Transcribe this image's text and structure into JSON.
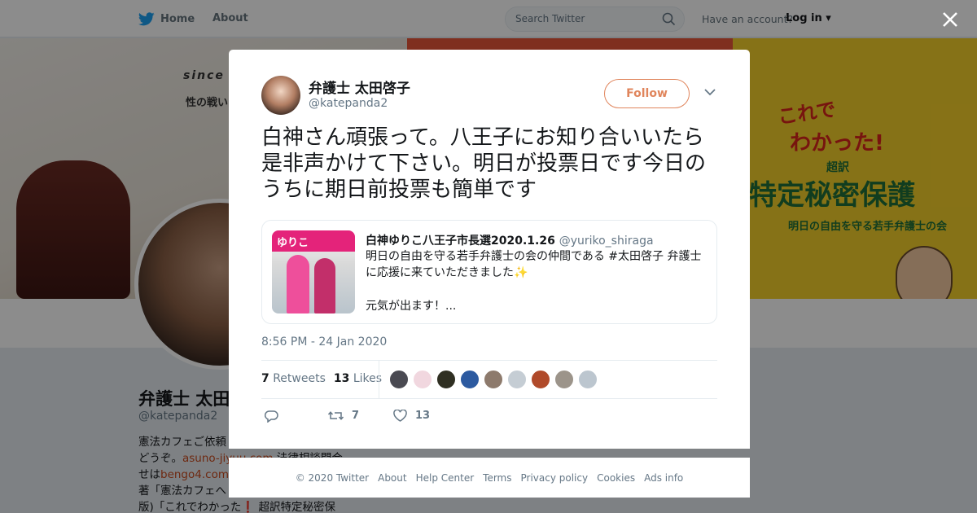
{
  "nav": {
    "home_label": "Home",
    "about_label": "About",
    "search_placeholder": "Search Twitter",
    "have_account": "Have an account?",
    "login_label": "Log in"
  },
  "banner": {
    "since_text": "since",
    "left_line": "性の戦い",
    "book_title1": "これで",
    "book_title2": "わかった!",
    "book_chouyaku": "超訳",
    "book_main": "特定秘密保護",
    "book_sub": "明日の自由を守る若手弁護士の会"
  },
  "profile": {
    "name": "弁護士 太田",
    "handle": "@katepanda2",
    "bio_line1": "憲法カフェご依頼",
    "bio_line2_pre": "どうぞ。",
    "bio_link1": "asuno-jiyuu.com",
    "bio_line2_post": " 法律相談問合",
    "bio_line3_pre": "せは",
    "bio_link2": "bengo4.com/",
    "bio_line4": "著「憲法カフェへ",
    "bio_line5": "版)「これでわかった❗ 超訳特定秘密保"
  },
  "tweet": {
    "author_name": "弁護士 太田啓子",
    "author_handle": "@katepanda2",
    "follow_label": "Follow",
    "text": "白神さん頑張って。八王子にお知り合いいたら是非声かけて下さい。明日が投票日です今日のうちに期日前投票も簡単です",
    "time": "8:56 PM - 24 Jan 2020",
    "retweets_count": "7",
    "retweets_label": "Retweets",
    "likes_count": "13",
    "likes_label": "Likes",
    "reply_count": "",
    "rt_action_count": "7",
    "like_action_count": "13"
  },
  "quote": {
    "image_sign": "ゆりこ",
    "name": "白神ゆりこ八王子市長選2020.1.26",
    "handle": "@yuriko_shiraga",
    "text": "明日の自由を守る若手弁護士の会の仲間である #太田啓子 弁護士に応援に来ていただきました",
    "sparkle": "✨",
    "more": "元気が出ます！..."
  },
  "likers": [
    {
      "color": "#4a4a52"
    },
    {
      "color": "#f1d7df"
    },
    {
      "color": "#2f2f22"
    },
    {
      "color": "#2c5aa0"
    },
    {
      "color": "#8d7a6c"
    },
    {
      "color": "#c5cdd4"
    },
    {
      "color": "#b04a2a"
    },
    {
      "color": "#9c948a"
    },
    {
      "color": "#bcc6cf"
    }
  ],
  "footer": {
    "copyright": "© 2020 Twitter",
    "about": "About",
    "help": "Help Center",
    "terms": "Terms",
    "privacy": "Privacy policy",
    "cookies": "Cookies",
    "ads": "Ads info"
  },
  "colors": {
    "accent": "#e0855c",
    "twitter_blue": "#1da1f2",
    "link": "#c84b1f"
  }
}
